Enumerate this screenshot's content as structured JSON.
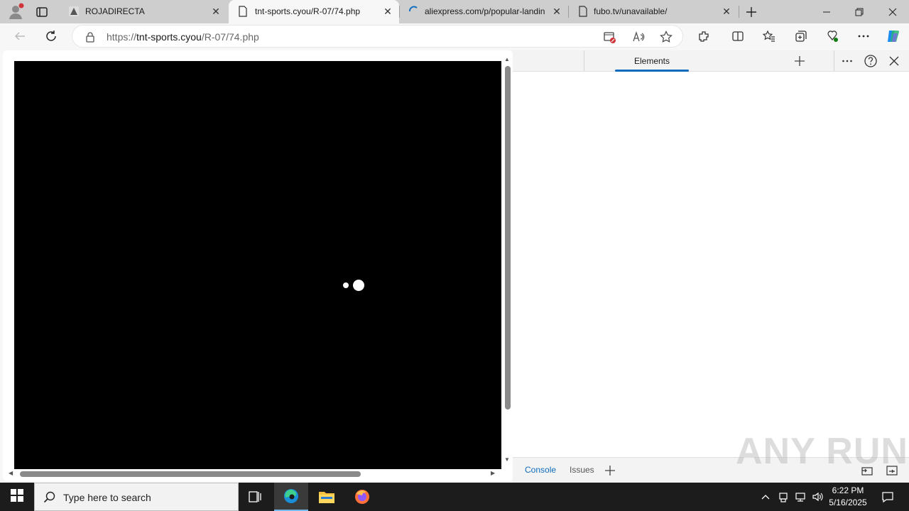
{
  "tabs": [
    {
      "title": "ROJADIRECTA",
      "icon": "rojadirecta-favicon"
    },
    {
      "title": "tnt-sports.cyou/R-07/74.php",
      "icon": "page-icon"
    },
    {
      "title": "aliexpress.com/p/popular-landin",
      "icon": "loading-spinner-icon"
    },
    {
      "title": "fubo.tv/unavailable/",
      "icon": "page-icon"
    }
  ],
  "address": {
    "scheme": "https://",
    "host": "tnt-sports.cyou",
    "path": "/R-07/74.php"
  },
  "devtools": {
    "tab_label": "Elements",
    "footer_tabs": [
      "Console",
      "Issues"
    ]
  },
  "watermark": "ANY RUN",
  "taskbar": {
    "search_placeholder": "Type here to search",
    "time": "6:22 PM",
    "date": "5/16/2025"
  },
  "colors": {
    "accent": "#0f6cbd",
    "taskbar": "#1c1c1c",
    "tabbar": "#cecece"
  }
}
